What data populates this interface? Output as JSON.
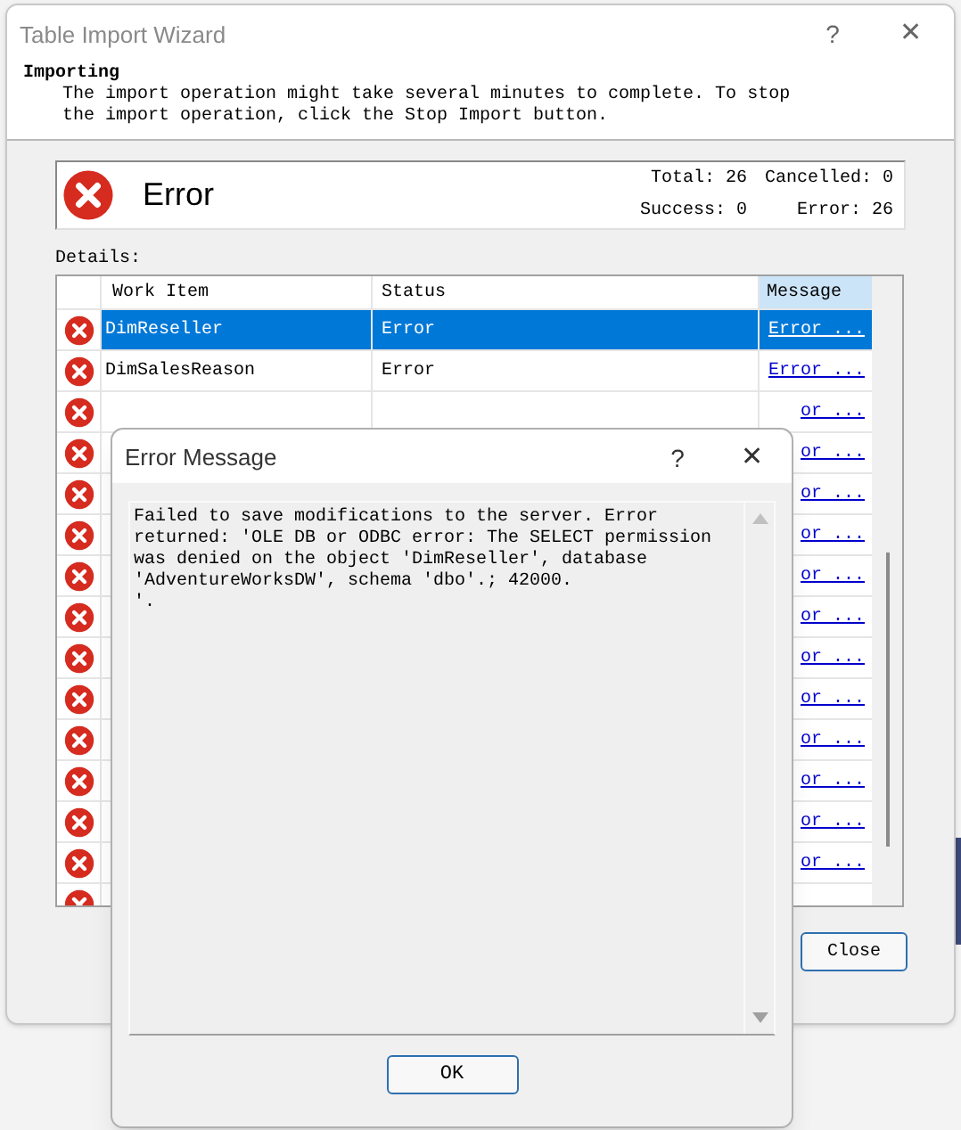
{
  "window": {
    "title": "Table Import Wizard",
    "help": "?",
    "close": "✕"
  },
  "header": {
    "title": "Importing",
    "description": "The import operation might take several minutes to complete. To stop\nthe import operation, click the Stop Import button."
  },
  "status": {
    "kind": "error",
    "title": "Error",
    "total": "Total: 26",
    "cancelled": "Cancelled: 0",
    "success": "Success: 0",
    "errors": "Error: 26"
  },
  "details_label": "Details:",
  "table": {
    "columns": [
      "Work Item",
      "Status",
      "Message"
    ],
    "rows": [
      {
        "kind": "error",
        "selected": true,
        "work_item": "DimReseller",
        "status": "Error",
        "message": "Error ..."
      },
      {
        "kind": "error",
        "selected": false,
        "work_item": "DimSalesReason",
        "status": "Error",
        "message": "Error ..."
      },
      {
        "kind": "error",
        "selected": false,
        "message": "or ..."
      },
      {
        "kind": "error",
        "selected": false,
        "message": "or ..."
      },
      {
        "kind": "error",
        "selected": false,
        "message": "or ..."
      },
      {
        "kind": "error",
        "selected": false,
        "message": "or ..."
      },
      {
        "kind": "error",
        "selected": false,
        "message": "or ..."
      },
      {
        "kind": "error",
        "selected": false,
        "message": "or ..."
      },
      {
        "kind": "error",
        "selected": false,
        "message": "or ..."
      },
      {
        "kind": "error",
        "selected": false,
        "message": "or ..."
      },
      {
        "kind": "error",
        "selected": false,
        "message": "or ..."
      },
      {
        "kind": "error",
        "selected": false,
        "message": "or ..."
      },
      {
        "kind": "error",
        "selected": false,
        "message": "or ..."
      },
      {
        "kind": "error",
        "selected": false,
        "message": "or ..."
      },
      {
        "kind": "error",
        "selected": false
      }
    ]
  },
  "buttons": [
    "Close"
  ],
  "dialog": {
    "title": "Error Message",
    "help": "?",
    "close": "✕",
    "message": "Failed to save modifications to the server. Error\nreturned: 'OLE DB or ODBC error: The SELECT permission\nwas denied on the object 'DimReseller', database\n'AdventureWorksDW', schema 'dbo'.; 42000.\n'.",
    "ok": "OK"
  }
}
